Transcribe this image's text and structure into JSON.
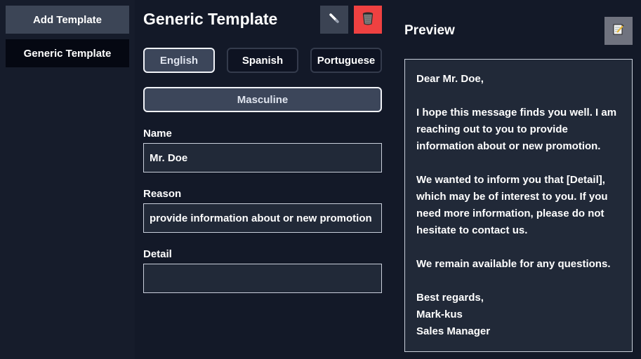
{
  "sidebar": {
    "add_button": "Add Template",
    "items": [
      {
        "label": "Generic Template",
        "selected": true
      }
    ]
  },
  "editor": {
    "title": "Generic Template",
    "edit_icon": "pencil-icon",
    "delete_icon": "trash-icon",
    "delete_color": "#ef4141",
    "languages": [
      {
        "label": "English",
        "active": true
      },
      {
        "label": "Spanish",
        "active": false
      },
      {
        "label": "Portuguese",
        "active": false
      }
    ],
    "gender": "Masculine",
    "fields": [
      {
        "label": "Name",
        "value": "Mr. Doe",
        "placeholder": ""
      },
      {
        "label": "Reason",
        "value": "provide information about or new promotion",
        "placeholder": ""
      },
      {
        "label": "Detail",
        "value": "",
        "placeholder": ""
      }
    ]
  },
  "preview": {
    "title": "Preview",
    "notes_icon": "memo-icon",
    "greeting": "Dear Mr. Doe,",
    "paragraph1": "I hope this message finds you well. I am reaching out to you to provide information about or new promotion.",
    "paragraph2": "We wanted to inform you that [Detail], which may be of interest to you. If you need more information, please do not hesitate to contact us.",
    "paragraph3": "We remain available for any questions.",
    "closing": "Best regards,",
    "signature_name": "Mark-kus",
    "signature_title": "Sales Manager"
  }
}
